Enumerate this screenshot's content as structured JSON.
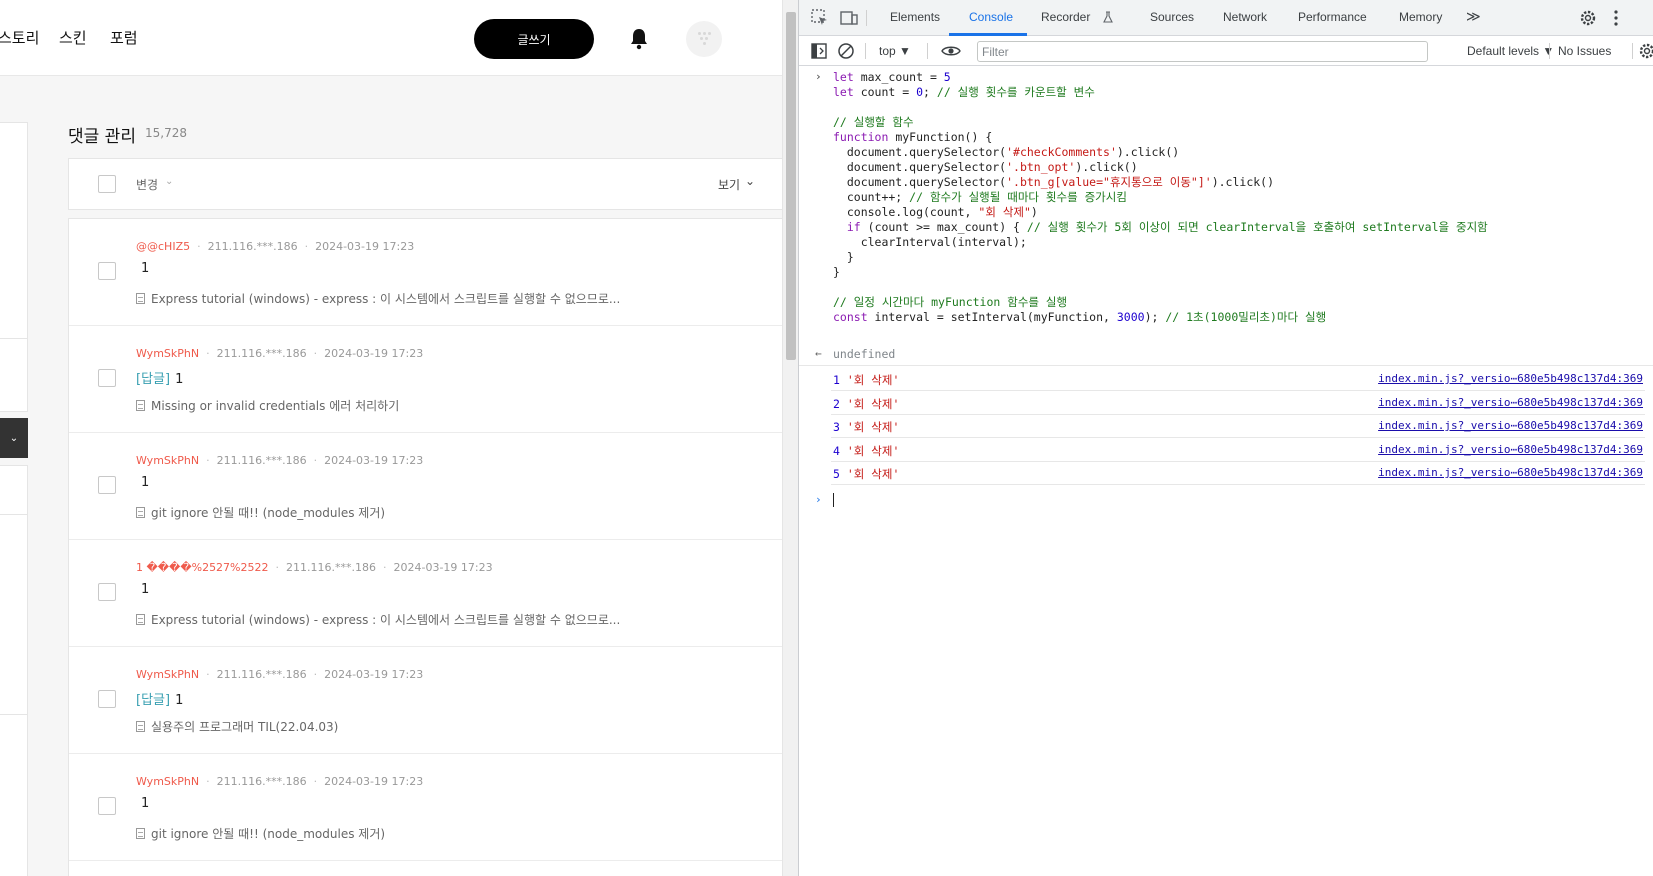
{
  "blog": {
    "nav": [
      "스토리",
      "스킨",
      "포럼"
    ],
    "write_button": "글쓰기",
    "page_title": "댓글 관리",
    "comment_count": "15,728",
    "header": {
      "change": "변경",
      "view": "보기"
    },
    "comments": [
      {
        "author": "@@cHIZ5",
        "ip": "211.116.***.186",
        "date": "2024-03-19 17:23",
        "reply": "",
        "content": "1",
        "post": "Express tutorial (windows) - express : 이 시스템에서 스크립트를 실행할 수 없으므로..."
      },
      {
        "author": "WymSkPhN",
        "ip": "211.116.***.186",
        "date": "2024-03-19 17:23",
        "reply": "[답글]",
        "content": "1",
        "post": "Missing or invalid credentials 에러 처리하기"
      },
      {
        "author": "WymSkPhN",
        "ip": "211.116.***.186",
        "date": "2024-03-19 17:23",
        "reply": "",
        "content": "1",
        "post": "git ignore 안될 때!! (node_modules 제거)"
      },
      {
        "author": "1 ����%2527%2522",
        "ip": "211.116.***.186",
        "date": "2024-03-19 17:23",
        "reply": "",
        "content": "1",
        "post": "Express tutorial (windows) - express : 이 시스템에서 스크립트를 실행할 수 없으므로..."
      },
      {
        "author": "WymSkPhN",
        "ip": "211.116.***.186",
        "date": "2024-03-19 17:23",
        "reply": "[답글]",
        "content": "1",
        "post": "실용주의 프로그래머 TIL(22.04.03)"
      },
      {
        "author": "WymSkPhN",
        "ip": "211.116.***.186",
        "date": "2024-03-19 17:23",
        "reply": "",
        "content": "1",
        "post": "git ignore 안될 때!! (node_modules 제거)"
      }
    ]
  },
  "devtools": {
    "tabs": [
      "Elements",
      "Console",
      "Recorder",
      "Sources",
      "Network",
      "Performance",
      "Memory"
    ],
    "active_tab": "Console",
    "more_tabs": "≫",
    "context": "top",
    "filter_placeholder": "Filter",
    "levels": "Default levels",
    "issues": "No Issues",
    "code_lines": [
      "let max_count = 5",
      "let count = 0; // 실행 횟수를 카운트할 변수",
      "",
      "// 실행할 함수",
      "function myFunction() {",
      "  document.querySelector('#checkComments').click()",
      "  document.querySelector('.btn_opt').click()",
      "  document.querySelector('.btn_g[value=\"휴지통으로 이동\"]').click()",
      "  count++; // 함수가 실행될 때마다 횟수를 증가시킴",
      "  console.log(count, \"회 삭제\")",
      "  if (count >= max_count) { // 실행 횟수가 5회 이상이 되면 clearInterval을 호출하여 setInterval을 중지함",
      "    clearInterval(interval);",
      "  }",
      "}",
      "",
      "// 일정 시간마다 myFunction 함수를 실행",
      "const interval = setInterval(myFunction, 3000); // 1초(1000밀리초)마다 실행"
    ],
    "return_value": "undefined",
    "logs": [
      {
        "num": "1",
        "text": "'회 삭제'",
        "source": "index.min.js?_versio⋯680e5b498c137d4:369"
      },
      {
        "num": "2",
        "text": "'회 삭제'",
        "source": "index.min.js?_versio⋯680e5b498c137d4:369"
      },
      {
        "num": "3",
        "text": "'회 삭제'",
        "source": "index.min.js?_versio⋯680e5b498c137d4:369"
      },
      {
        "num": "4",
        "text": "'회 삭제'",
        "source": "index.min.js?_versio⋯680e5b498c137d4:369"
      },
      {
        "num": "5",
        "text": "'회 삭제'",
        "source": "index.min.js?_versio⋯680e5b498c137d4:369"
      }
    ]
  }
}
